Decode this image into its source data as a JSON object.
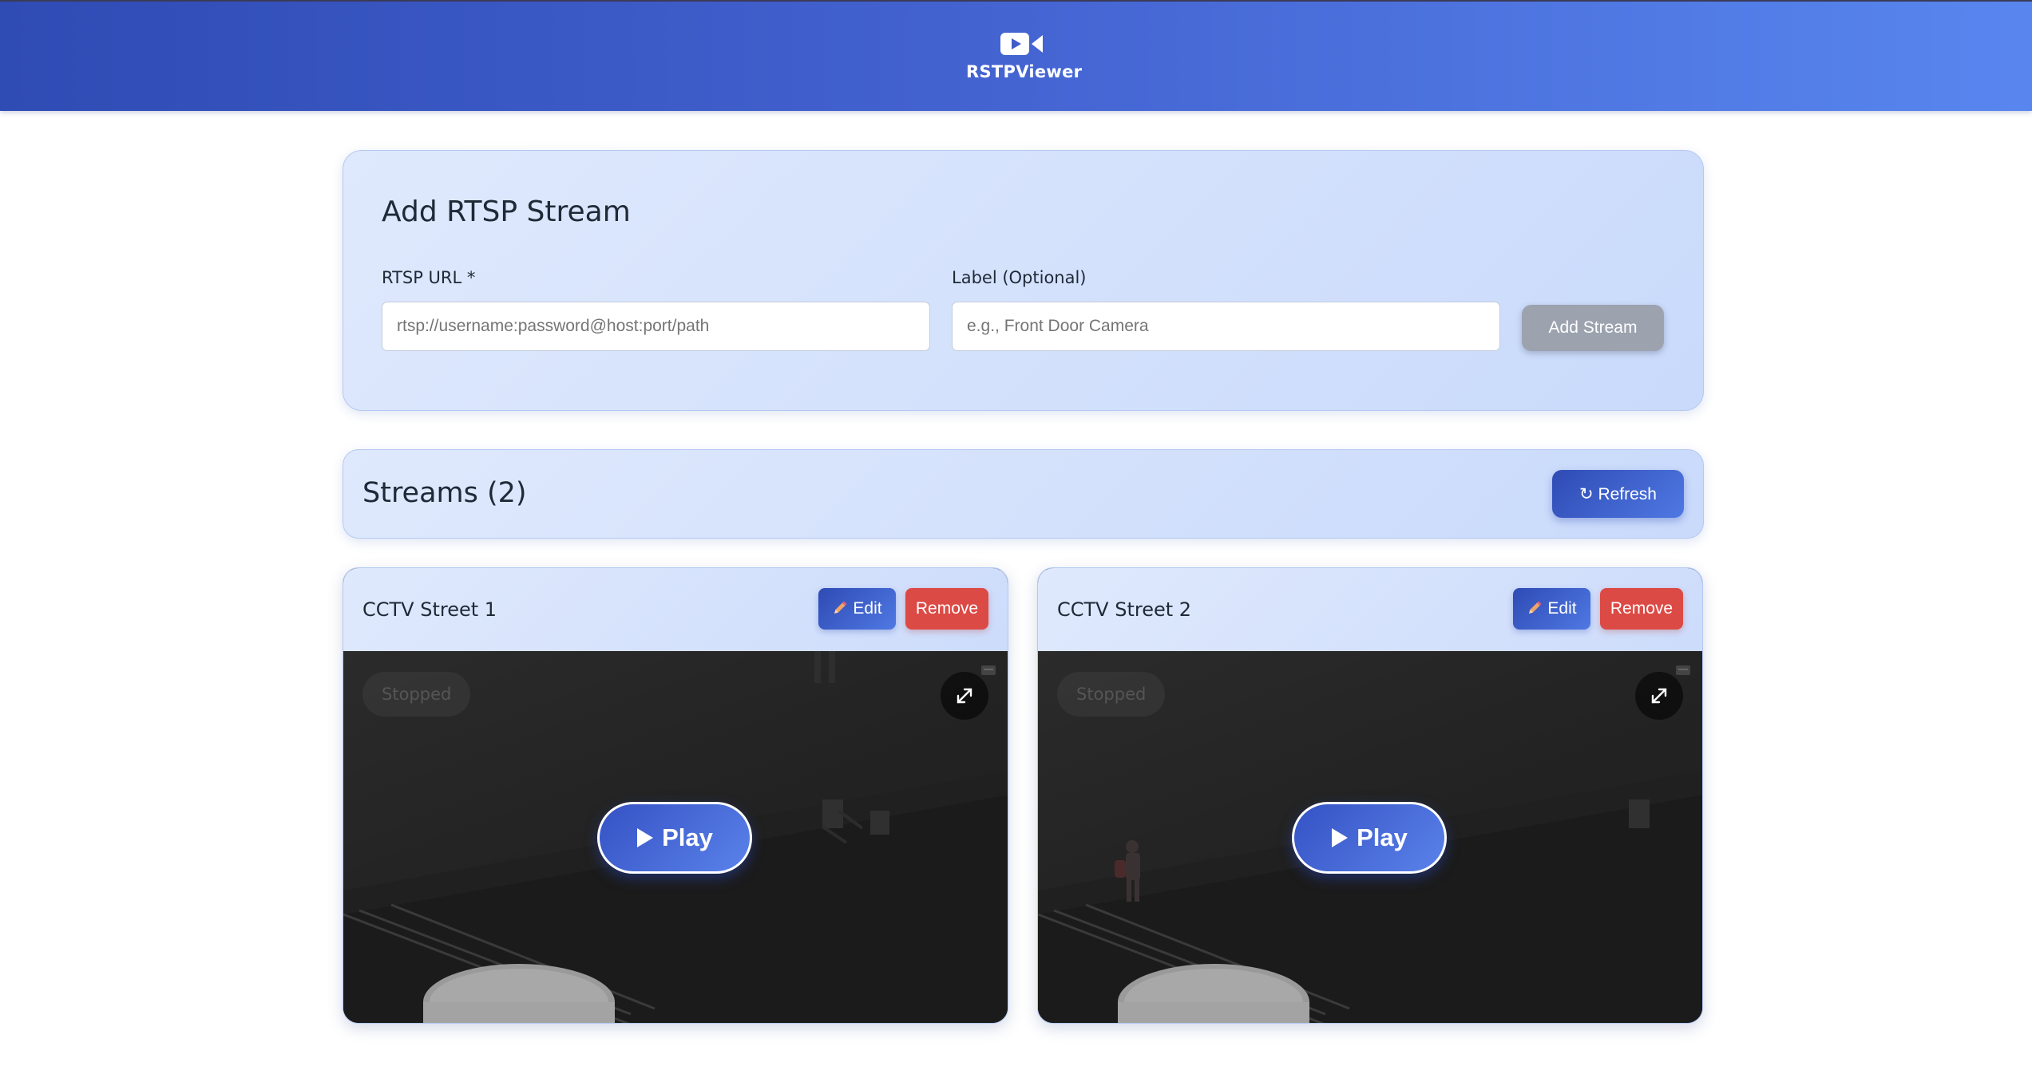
{
  "app": {
    "name": "RSTPViewer",
    "icon": "video-camera-icon"
  },
  "add_stream": {
    "title": "Add RTSP Stream",
    "url_label": "RTSP URL *",
    "url_placeholder": "rtsp://username:password@host:port/path",
    "label_label": "Label (Optional)",
    "label_placeholder": "e.g., Front Door Camera",
    "submit_label": "Add Stream"
  },
  "streams": {
    "title": "Streams (2)",
    "refresh_label": "↻ Refresh",
    "edit_label": "Edit",
    "remove_label": "Remove",
    "play_label": "Play",
    "items": [
      {
        "name": "CCTV Street 1",
        "status": "Stopped"
      },
      {
        "name": "CCTV Street 2",
        "status": "Stopped"
      }
    ]
  },
  "colors": {
    "header_start": "#2f4bb4",
    "header_end": "#5886ef",
    "card_bg": "#dfe9fd",
    "primary_button": "#3f63d3",
    "remove_button": "#dc4a45",
    "disabled_button": "#9ca3af"
  }
}
